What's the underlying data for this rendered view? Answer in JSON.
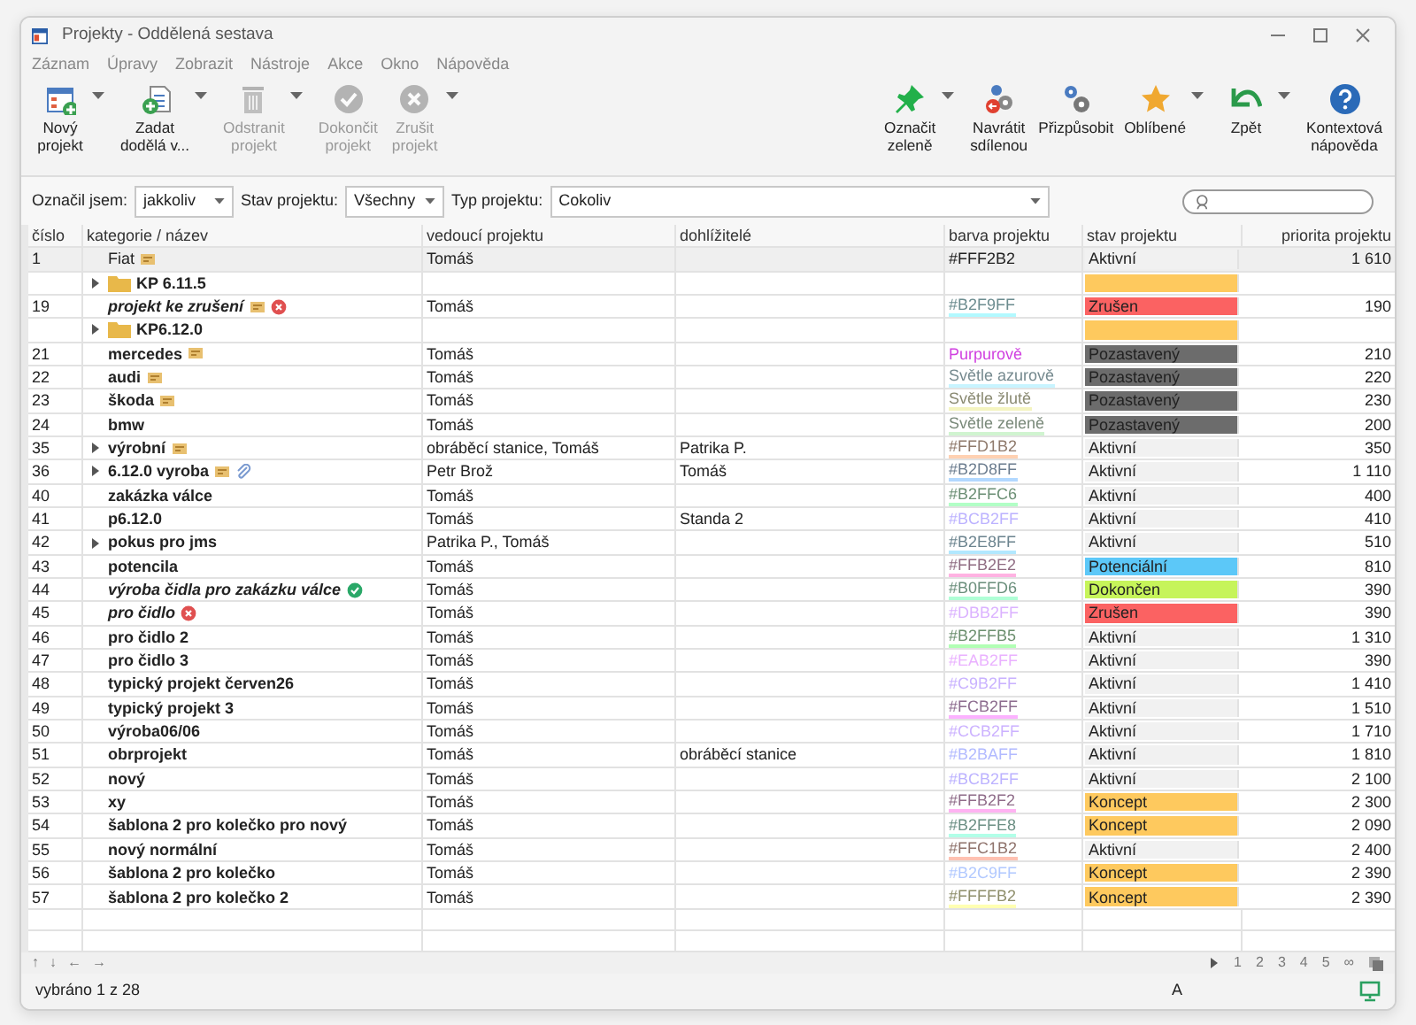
{
  "window": {
    "title": "Projekty - Oddělená sestava"
  },
  "menu": [
    "Záznam",
    "Úpravy",
    "Zobrazit",
    "Nástroje",
    "Akce",
    "Okno",
    "Nápověda"
  ],
  "toolbar_left": [
    {
      "kind": "new",
      "label": "Nový\nprojekt",
      "disabled": false,
      "dropdown": true
    },
    {
      "kind": "add",
      "label": "Zadat\ndodělá v...",
      "disabled": false,
      "dropdown": true
    },
    {
      "kind": "trash",
      "label": "Odstranit\nprojekt",
      "disabled": true,
      "dropdown": true
    },
    {
      "kind": "check",
      "label": "Dokončit\nprojekt",
      "disabled": true,
      "dropdown": false
    },
    {
      "kind": "cancel",
      "label": "Zrušit\nprojekt",
      "disabled": true,
      "dropdown": true
    }
  ],
  "toolbar_right": [
    {
      "kind": "pin",
      "label": "Označit\nzeleně",
      "disabled": false,
      "dropdown": true
    },
    {
      "kind": "gears",
      "label": "Navrátit\nsdílenou",
      "disabled": false,
      "dropdown": false
    },
    {
      "kind": "gear",
      "label": "Přizpůsobit",
      "disabled": false,
      "dropdown": false
    },
    {
      "kind": "star",
      "label": "Oblíbené",
      "disabled": false,
      "dropdown": true
    },
    {
      "kind": "undo",
      "label": "Zpět",
      "disabled": false,
      "dropdown": true
    },
    {
      "kind": "help",
      "label": "Kontextová\nnápověda",
      "disabled": false,
      "dropdown": false
    }
  ],
  "filters": [
    {
      "label": "Označil jsem:",
      "value": "jakkoliv",
      "kind": "short"
    },
    {
      "label": "Stav projektu:",
      "value": "Všechny",
      "kind": "short"
    },
    {
      "label": "Typ projektu:",
      "value": "Cokoliv",
      "kind": "wide"
    }
  ],
  "table": {
    "columns": [
      "číslo",
      "kategorie / název",
      "vedoucí projektu",
      "dohlížitelé",
      "barva projektu",
      "stav projektu",
      "priorita projektu"
    ],
    "rows": [
      {
        "number": "1",
        "name": "Fiat",
        "kind": "plain",
        "markers": [
          {
            "kind": "note"
          }
        ],
        "leader": "Tomáš",
        "project_color": {
          "label": "#FFF2B2"
        },
        "status": {
          "label": "Aktivní",
          "color": "#f1f1f1"
        },
        "priority": "1 610",
        "selected": true
      },
      {
        "name": "KP 6.11.5",
        "kind": "folder",
        "expanded": false,
        "status": {
          "color": "#fec95e"
        },
        "selected": false
      },
      {
        "number": "19",
        "name": "projekt ke zrušení",
        "kind": "closed",
        "markers": [
          {
            "kind": "note"
          },
          {
            "kind": "cancel"
          }
        ],
        "leader": "Tomáš",
        "project_color": {
          "label": "#B2F9FF",
          "color": "#b2f9ff"
        },
        "status": {
          "label": "Zrušen",
          "color": "#fb6262"
        },
        "priority": "190",
        "selected": false
      },
      {
        "name": "KP6.12.0",
        "kind": "folder",
        "expanded": false,
        "status": {
          "color": "#fec95e"
        },
        "selected": false
      },
      {
        "number": "21",
        "name": "mercedes",
        "kind": "project",
        "markers": [
          {
            "kind": "note"
          }
        ],
        "leader": "Tomáš",
        "project_color": {
          "label": "Purpurově",
          "color": "#d040e0"
        },
        "status": {
          "label": "Pozastavený",
          "color": "#6c6c6c"
        },
        "priority": "210",
        "selected": false
      },
      {
        "number": "22",
        "name": "audi",
        "kind": "project",
        "markers": [
          {
            "kind": "note"
          }
        ],
        "leader": "Tomáš",
        "project_color": {
          "label": "Světle azurově",
          "color": "#c8f4ff"
        },
        "status": {
          "label": "Pozastavený",
          "color": "#6c6c6c"
        },
        "priority": "220",
        "selected": false
      },
      {
        "number": "23",
        "name": "škoda",
        "kind": "project",
        "markers": [
          {
            "kind": "note"
          }
        ],
        "leader": "Tomáš",
        "project_color": {
          "label": "Světle žlutě",
          "color": "#f4f4c0"
        },
        "status": {
          "label": "Pozastavený",
          "color": "#6c6c6c"
        },
        "priority": "230",
        "selected": false
      },
      {
        "number": "24",
        "name": "bmw",
        "kind": "project",
        "leader": "Tomáš",
        "project_color": {
          "label": "Světle zeleně",
          "color": "#d0f4d0"
        },
        "status": {
          "label": "Pozastavený",
          "color": "#6c6c6c"
        },
        "priority": "200",
        "selected": false
      },
      {
        "number": "35",
        "name": "výrobní",
        "kind": "project",
        "expanded": false,
        "markers": [
          {
            "kind": "note"
          }
        ],
        "leader": "obráběcí stanice, Tomáš",
        "supervisors": "Patrika P.",
        "project_color": {
          "label": "#FFD1B2",
          "color": "#ffd1b2"
        },
        "status": {
          "label": "Aktivní",
          "color": "#f1f1f1"
        },
        "priority": "350",
        "selected": false
      },
      {
        "number": "36",
        "name": "6.12.0 vyroba",
        "kind": "project",
        "expanded": false,
        "markers": [
          {
            "kind": "note"
          },
          {
            "kind": "attach"
          }
        ],
        "leader": "Petr Brož",
        "supervisors": "Tomáš",
        "project_color": {
          "label": "#B2D8FF",
          "color": "#b2d8ff"
        },
        "status": {
          "label": "Aktivní",
          "color": "#f1f1f1"
        },
        "priority": "1 110",
        "selected": false
      },
      {
        "number": "40",
        "name": "zakázka válce",
        "kind": "project",
        "leader": "Tomáš",
        "project_color": {
          "label": "#B2FFC6",
          "color": "#b2ffc6"
        },
        "status": {
          "label": "Aktivní",
          "color": "#f1f1f1"
        },
        "priority": "400",
        "selected": false
      },
      {
        "number": "41",
        "name": "p6.12.0",
        "kind": "project",
        "leader": "Tomáš",
        "supervisors": "Standa 2",
        "project_color": {
          "label": "#BCB2FF",
          "color": "#bcb2ff"
        },
        "status": {
          "label": "Aktivní",
          "color": "#f1f1f1"
        },
        "priority": "410",
        "selected": false
      },
      {
        "number": "42",
        "name": "pokus pro jms",
        "kind": "project",
        "expanded": false,
        "leader": "Patrika P., Tomáš",
        "project_color": {
          "label": "#B2E8FF",
          "color": "#b2e8ff"
        },
        "status": {
          "label": "Aktivní",
          "color": "#f1f1f1"
        },
        "priority": "510",
        "selected": false
      },
      {
        "number": "43",
        "name": "potencila",
        "kind": "project",
        "leader": "Tomáš",
        "project_color": {
          "label": "#FFB2E2",
          "color": "#ffb2e2"
        },
        "status": {
          "label": "Potenciální",
          "color": "#5cc8f8"
        },
        "priority": "810",
        "selected": false
      },
      {
        "number": "44",
        "name": "výroba čidla pro zakázku válce",
        "kind": "closed",
        "markers": [
          {
            "kind": "done"
          }
        ],
        "leader": "Tomáš",
        "project_color": {
          "label": "#B0FFD6",
          "color": "#b0ffd6"
        },
        "status": {
          "label": "Dokončen",
          "color": "#c6f45a"
        },
        "priority": "390",
        "selected": false
      },
      {
        "number": "45",
        "name": "pro čidlo",
        "kind": "closed",
        "markers": [
          {
            "kind": "cancel"
          }
        ],
        "leader": "Tomáš",
        "project_color": {
          "label": "#DBB2FF",
          "color": "#dbb2ff"
        },
        "status": {
          "label": "Zrušen",
          "color": "#fb6262"
        },
        "priority": "390",
        "selected": false
      },
      {
        "number": "46",
        "name": "pro čidlo 2",
        "kind": "project",
        "leader": "Tomáš",
        "project_color": {
          "label": "#B2FFB5",
          "color": "#b2ffb5"
        },
        "status": {
          "label": "Aktivní",
          "color": "#f1f1f1"
        },
        "priority": "1 310",
        "selected": false
      },
      {
        "number": "47",
        "name": "pro čidlo 3",
        "kind": "project",
        "leader": "Tomáš",
        "project_color": {
          "label": "#EAB2FF",
          "color": "#eab2ff"
        },
        "status": {
          "label": "Aktivní",
          "color": "#f1f1f1"
        },
        "priority": "390",
        "selected": false
      },
      {
        "number": "48",
        "name": "typický projekt červen26",
        "kind": "project",
        "leader": "Tomáš",
        "project_color": {
          "label": "#C9B2FF",
          "color": "#c9b2ff"
        },
        "status": {
          "label": "Aktivní",
          "color": "#f1f1f1"
        },
        "priority": "1 410",
        "selected": false
      },
      {
        "number": "49",
        "name": "typický projekt 3",
        "kind": "project",
        "leader": "Tomáš",
        "project_color": {
          "label": "#FCB2FF",
          "color": "#fcb2ff"
        },
        "status": {
          "label": "Aktivní",
          "color": "#f1f1f1"
        },
        "priority": "1 510",
        "selected": false
      },
      {
        "number": "50",
        "name": "výroba06/06",
        "kind": "project",
        "leader": "Tomáš",
        "project_color": {
          "label": "#CCB2FF",
          "color": "#ccb2ff"
        },
        "status": {
          "label": "Aktivní",
          "color": "#f1f1f1"
        },
        "priority": "1 710",
        "selected": false
      },
      {
        "number": "51",
        "name": "obrprojekt",
        "kind": "project",
        "leader": "Tomáš",
        "supervisors": "obráběcí stanice",
        "project_color": {
          "label": "#B2BAFF",
          "color": "#b2baff"
        },
        "status": {
          "label": "Aktivní",
          "color": "#f1f1f1"
        },
        "priority": "1 810",
        "selected": false
      },
      {
        "number": "52",
        "name": "nový",
        "kind": "project",
        "leader": "Tomáš",
        "project_color": {
          "label": "#BCB2FF",
          "color": "#bcb2ff"
        },
        "status": {
          "label": "Aktivní",
          "color": "#f1f1f1"
        },
        "priority": "2 100",
        "selected": false
      },
      {
        "number": "53",
        "name": "xy",
        "kind": "project",
        "leader": "Tomáš",
        "project_color": {
          "label": "#FFB2F2",
          "color": "#ffb2f2"
        },
        "status": {
          "label": "Koncept",
          "color": "#fec95e"
        },
        "priority": "2 300",
        "selected": false
      },
      {
        "number": "54",
        "name": "šablona 2 pro kolečko pro nový",
        "kind": "project",
        "leader": "Tomáš",
        "project_color": {
          "label": "#B2FFE8",
          "color": "#b2ffe8"
        },
        "status": {
          "label": "Koncept",
          "color": "#fec95e"
        },
        "priority": "2 090",
        "selected": false
      },
      {
        "number": "55",
        "name": "nový normální",
        "kind": "project",
        "leader": "Tomáš",
        "project_color": {
          "label": "#FFC1B2",
          "color": "#ffc1b2"
        },
        "status": {
          "label": "Aktivní",
          "color": "#f1f1f1"
        },
        "priority": "2 400",
        "selected": false
      },
      {
        "number": "56",
        "name": "šablona 2 pro kolečko",
        "kind": "project",
        "leader": "Tomáš",
        "project_color": {
          "label": "#B2C9FF",
          "color": "#b2c9ff"
        },
        "status": {
          "label": "Koncept",
          "color": "#fec95e"
        },
        "priority": "2 390",
        "selected": false
      },
      {
        "number": "57",
        "name": "šablona 2 pro kolečko 2",
        "kind": "project",
        "leader": "Tomáš",
        "project_color": {
          "label": "#FFFFB2",
          "color": "#ffffb2"
        },
        "status": {
          "label": "Koncept",
          "color": "#fec95e"
        },
        "priority": "2 390",
        "selected": false
      }
    ]
  },
  "navigator": {
    "arrows": [
      "↑",
      "↓",
      "←",
      "→"
    ],
    "pages": [
      "1",
      "2",
      "3",
      "4",
      "5",
      "∞"
    ]
  },
  "status_bar": {
    "selection": "vybráno 1 z 28",
    "indicator": "A"
  }
}
